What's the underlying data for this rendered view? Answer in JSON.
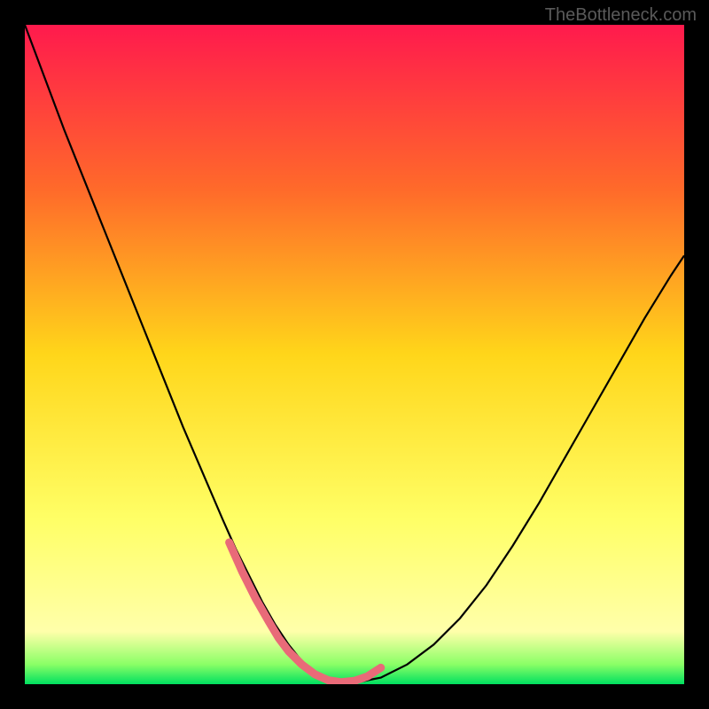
{
  "watermark": "TheBottleneck.com",
  "chart_data": {
    "type": "line",
    "title": "",
    "xlabel": "",
    "ylabel": "",
    "xlim": [
      0,
      100
    ],
    "ylim": [
      0,
      100
    ],
    "gradient_stops": [
      {
        "offset": 0,
        "color": "#ff1a4d"
      },
      {
        "offset": 25,
        "color": "#ff6a2a"
      },
      {
        "offset": 50,
        "color": "#ffd61a"
      },
      {
        "offset": 75,
        "color": "#ffff66"
      },
      {
        "offset": 92,
        "color": "#ffffaa"
      },
      {
        "offset": 97,
        "color": "#8aff66"
      },
      {
        "offset": 100,
        "color": "#00e060"
      }
    ],
    "series": [
      {
        "name": "bottleneck-curve",
        "color": "#000000",
        "width": 2.2,
        "x": [
          0,
          3,
          6,
          9,
          12,
          15,
          18,
          21,
          24,
          27,
          30,
          32,
          34,
          36,
          38,
          40,
          42,
          44,
          46,
          50,
          54,
          58,
          62,
          66,
          70,
          74,
          78,
          82,
          86,
          90,
          94,
          98,
          100
        ],
        "y": [
          100,
          92,
          84,
          76.5,
          69,
          61.5,
          54,
          46.5,
          39,
          32,
          25,
          20.5,
          16.5,
          12.5,
          9,
          6,
          3.5,
          1.5,
          0.3,
          0.2,
          1,
          3,
          6,
          10,
          15,
          21,
          27.5,
          34.5,
          41.5,
          48.5,
          55.5,
          62,
          65
        ]
      },
      {
        "name": "optimal-zone-marker",
        "color": "#e96a78",
        "width": 9,
        "linecap": "round",
        "x": [
          31,
          33,
          35,
          37,
          38.5,
          40,
          42,
          44,
          46,
          48,
          50,
          52,
          54
        ],
        "y": [
          21.5,
          17,
          13,
          9.5,
          7,
          5,
          3,
          1.5,
          0.6,
          0.3,
          0.5,
          1.2,
          2.5
        ]
      }
    ]
  }
}
